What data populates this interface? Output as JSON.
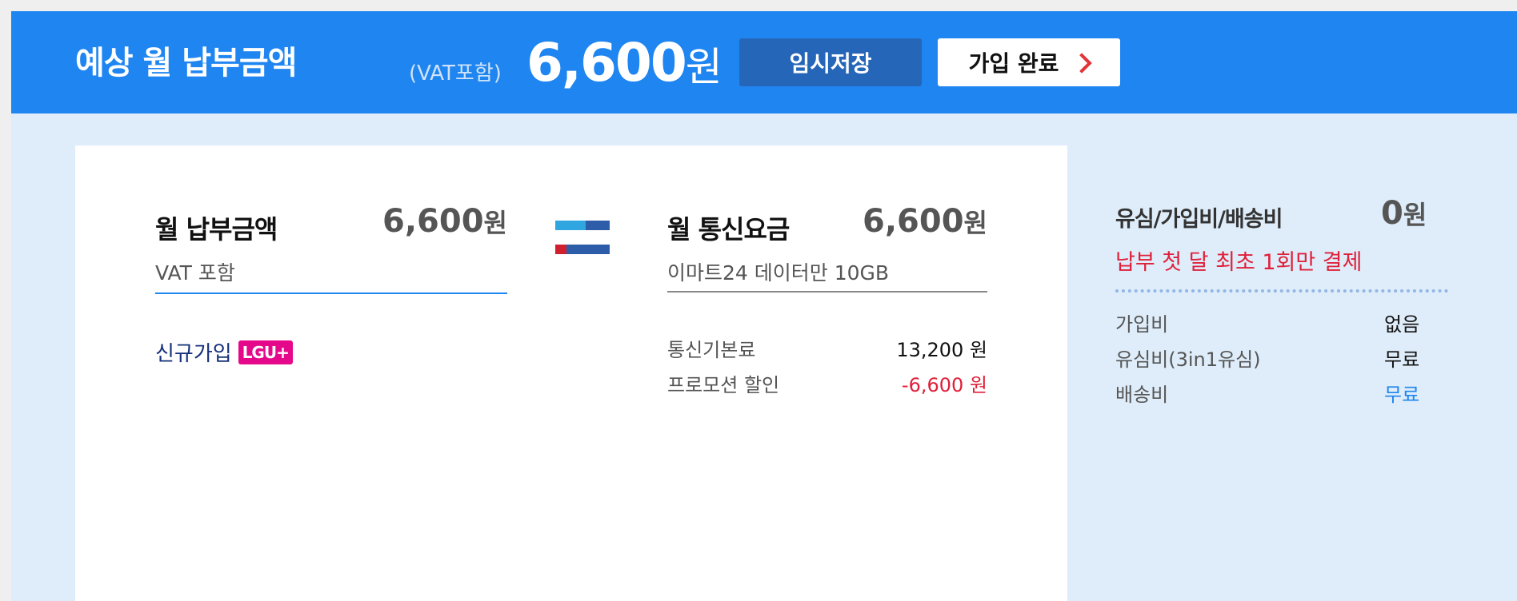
{
  "header": {
    "title": "예상 월 납부금액",
    "vat_note": "(VAT포함)",
    "amount": "6,600",
    "currency": "원",
    "save_button": "임시저장",
    "complete_button": "가입 완료"
  },
  "monthly_payment": {
    "title": "월 납부금액",
    "amount": "6,600",
    "currency": "원",
    "note": "VAT 포함",
    "join_type": "신규가입",
    "carrier_badge": "LGU+"
  },
  "monthly_fee": {
    "title": "월 통신요금",
    "amount": "6,600",
    "currency": "원",
    "plan_name": "이마트24 데이터만 10GB",
    "items": [
      {
        "label": "통신기본료",
        "value": "13,200 원"
      },
      {
        "label": "프로모션 할인",
        "value": "-6,600 원"
      }
    ]
  },
  "one_time_fees": {
    "title": "유심/가입비/배송비",
    "amount": "0",
    "currency": "원",
    "note": "납부 첫 달 최초 1회만 결제",
    "items": [
      {
        "label": "가입비",
        "value": "없음"
      },
      {
        "label": "유심비(3in1유심)",
        "value": "무료"
      },
      {
        "label": "배송비",
        "value": "무료"
      }
    ]
  },
  "colors": {
    "header_blue": "#1f85f0",
    "save_button": "#2666b8",
    "background": "#deedf9",
    "discount_red": "#e0203a",
    "badge_magenta": "#e5088a"
  },
  "icons": {
    "complete_chevron": "chevron-right-icon",
    "brand_flag": "emart-flag-icon"
  }
}
